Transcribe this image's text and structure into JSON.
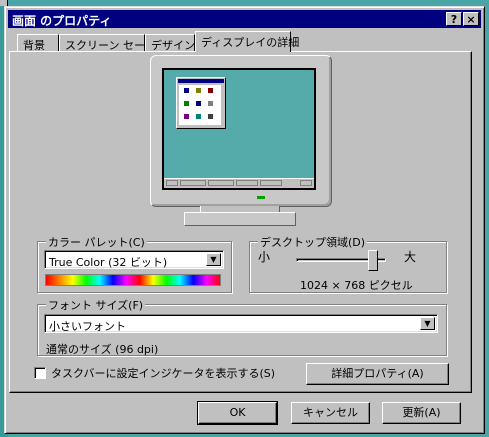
{
  "window": {
    "title": "画面 のプロパティ",
    "help_glyph": "?",
    "close_glyph": "×"
  },
  "tabs": [
    {
      "label": "背景"
    },
    {
      "label": "スクリーン セーバー"
    },
    {
      "label": "デザイン"
    },
    {
      "label": "ディスプレイの詳細",
      "active": true
    }
  ],
  "color_palette": {
    "label": "カラー パレット(C)",
    "selected": "True Color (32 ビット)"
  },
  "desktop_area": {
    "label": "デスクトップ領域(D)",
    "min_label": "小",
    "max_label": "大",
    "resolution": "1024 × 768 ピクセル",
    "slider_level": 0.9
  },
  "font_size": {
    "label": "フォント サイズ(F)",
    "selected": "小さいフォント",
    "description": "通常のサイズ (96 dpi)"
  },
  "taskbar_indicator": {
    "label": "タスクバーに設定インジケータを表示する(S)",
    "checked": false
  },
  "buttons": {
    "advanced": "詳細プロパティ(A)",
    "ok": "OK",
    "cancel": "キャンセル",
    "apply": "更新(A)"
  },
  "colors": {
    "desktop": "#4aa6a6",
    "titlebar": "#000080",
    "face": "#c0c0c0"
  },
  "icons": [
    "help-icon",
    "close-icon",
    "monitor-icon",
    "dropdown-arrow-icon"
  ]
}
